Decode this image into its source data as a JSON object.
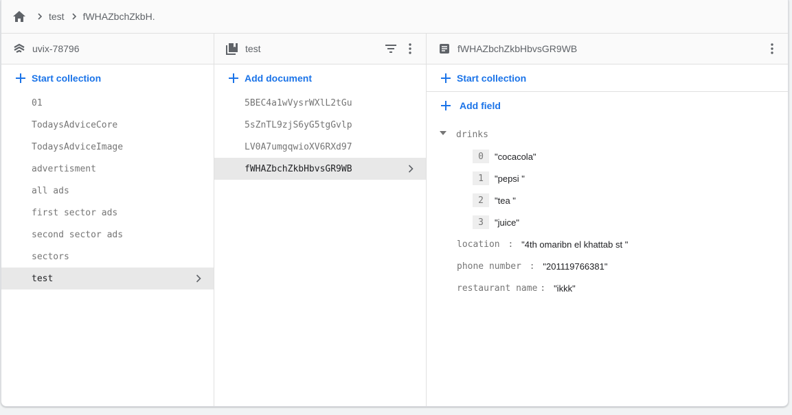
{
  "breadcrumb": {
    "home_icon": "home-icon",
    "items": [
      "test",
      "fWHAZbchZkbH."
    ]
  },
  "root_column": {
    "title": "uvix-78796",
    "icon": "firestore-database-icon",
    "action_label": "Start collection",
    "items": [
      {
        "label": "01",
        "selected": false
      },
      {
        "label": "TodaysAdviceCore",
        "selected": false
      },
      {
        "label": "TodaysAdviceImage",
        "selected": false
      },
      {
        "label": "advertisment",
        "selected": false
      },
      {
        "label": "all ads",
        "selected": false
      },
      {
        "label": "first sector ads",
        "selected": false
      },
      {
        "label": "second sector ads",
        "selected": false
      },
      {
        "label": "sectors",
        "selected": false
      },
      {
        "label": "test",
        "selected": true
      }
    ]
  },
  "collection_column": {
    "title": "test",
    "icon": "collection-icon",
    "filter_icon": "filter-icon",
    "more_icon": "more-vert-icon",
    "action_label": "Add document",
    "items": [
      {
        "label": "5BEC4a1wVysrWXlL2tGu",
        "selected": false
      },
      {
        "label": "5sZnTL9zjS6yG5tgGvlp",
        "selected": false
      },
      {
        "label": "LV0A7umgqwioXV6RXd97",
        "selected": false
      },
      {
        "label": "fWHAZbchZkbHbvsGR9WB",
        "selected": true
      }
    ]
  },
  "document_column": {
    "title": "fWHAZbchZkbHbvsGR9WB",
    "icon": "document-icon",
    "more_icon": "more-vert-icon",
    "start_collection_label": "Start collection",
    "add_field_label": "Add field",
    "array_field": {
      "key": "drinks",
      "expanded": true,
      "items": [
        {
          "index": "0",
          "value": "\"cocacola\""
        },
        {
          "index": "1",
          "value": "\"pepsi \""
        },
        {
          "index": "2",
          "value": "\"tea \""
        },
        {
          "index": "3",
          "value": "\"juice\""
        }
      ]
    },
    "fields": [
      {
        "key": "location",
        "sep": " : ",
        "value": "\"4th omaribn el khattab st \""
      },
      {
        "key": "phone number",
        "sep": " : ",
        "value": "\"201119766381\""
      },
      {
        "key": "restaurant name",
        "sep": ": ",
        "value": "\"ikkk\""
      }
    ]
  },
  "colors": {
    "accent": "#1a73e8",
    "annotation": "#e02020"
  }
}
